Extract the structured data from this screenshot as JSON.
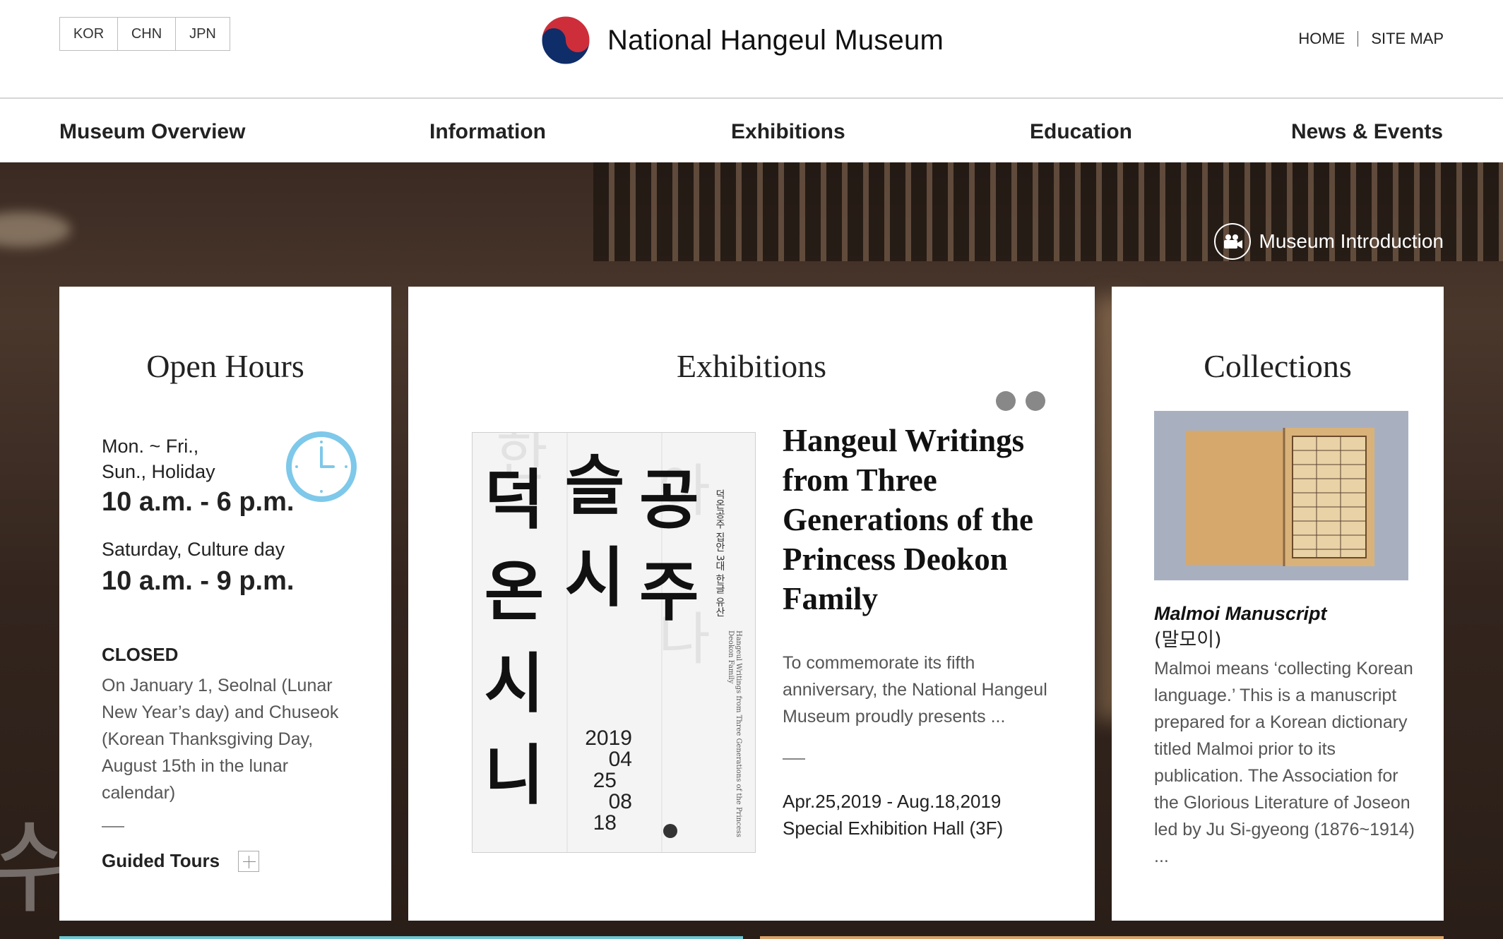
{
  "header": {
    "languages": [
      "KOR",
      "CHN",
      "JPN"
    ],
    "logo_text": "National Hangeul Museum",
    "utility": {
      "home": "HOME",
      "sitemap": "SITE MAP"
    }
  },
  "nav": {
    "items": [
      "Museum Overview",
      "Information",
      "Exhibitions",
      "Education",
      "News & Events"
    ]
  },
  "hero": {
    "intro_label": "Museum Introduction",
    "bg_text": "쉬"
  },
  "open_hours": {
    "title": "Open Hours",
    "weekday_label_1": "Mon. ~ Fri.,",
    "weekday_label_2": "Sun., Holiday",
    "weekday_time": "10 a.m. - 6 p.m.",
    "weekend_label": "Saturday, Culture day",
    "weekend_time": "10 a.m. - 9 p.m.",
    "closed_title": "CLOSED",
    "closed_text": "On January 1, Seolnal (Lunar New Year’s day) and Chuseok (Korean Thanksgiving Day, August 15th in the lunar calendar)",
    "tours_label": "Guided Tours"
  },
  "exhibitions": {
    "title": "Exhibitions",
    "slide_count": 2,
    "poster": {
      "col1": "덕온시니",
      "col2": "슬시",
      "col3": "공주",
      "side_text": "덕온공주 집안 3대 한글 유산",
      "english": "Hangeul Writings from Three Generations of the Princess Deokon Family",
      "dates": [
        "2019",
        "04",
        "25",
        "08",
        "18"
      ]
    },
    "feature_title": "Hangeul Writings from Three Generations of the Princess Deokon Family",
    "feature_desc": "To commemorate its fifth anniversary, the National Hangeul Museum proudly presents ...",
    "feature_dates": "Apr.25,2019 - Aug.18,2019",
    "feature_place": "Special Exhibition Hall (3F)"
  },
  "collections": {
    "title": "Collections",
    "item_title": "Malmoi Manuscript",
    "item_sub": "(말모이)",
    "item_desc": "Malmoi means ‘collecting Korean language.’ This is a manuscript prepared for a Korean dictionary titled Malmoi prior to its publication. The Association for the Glorious Literature of Joseon led by Ju Si-gyeong (1876~1914) ..."
  },
  "colors": {
    "accent_teal": "#6ec6d0",
    "accent_orange": "#d9a36a",
    "clock_blue": "#7ec8ea",
    "logo_red": "#cd2e3a",
    "logo_blue": "#0f2d69"
  }
}
